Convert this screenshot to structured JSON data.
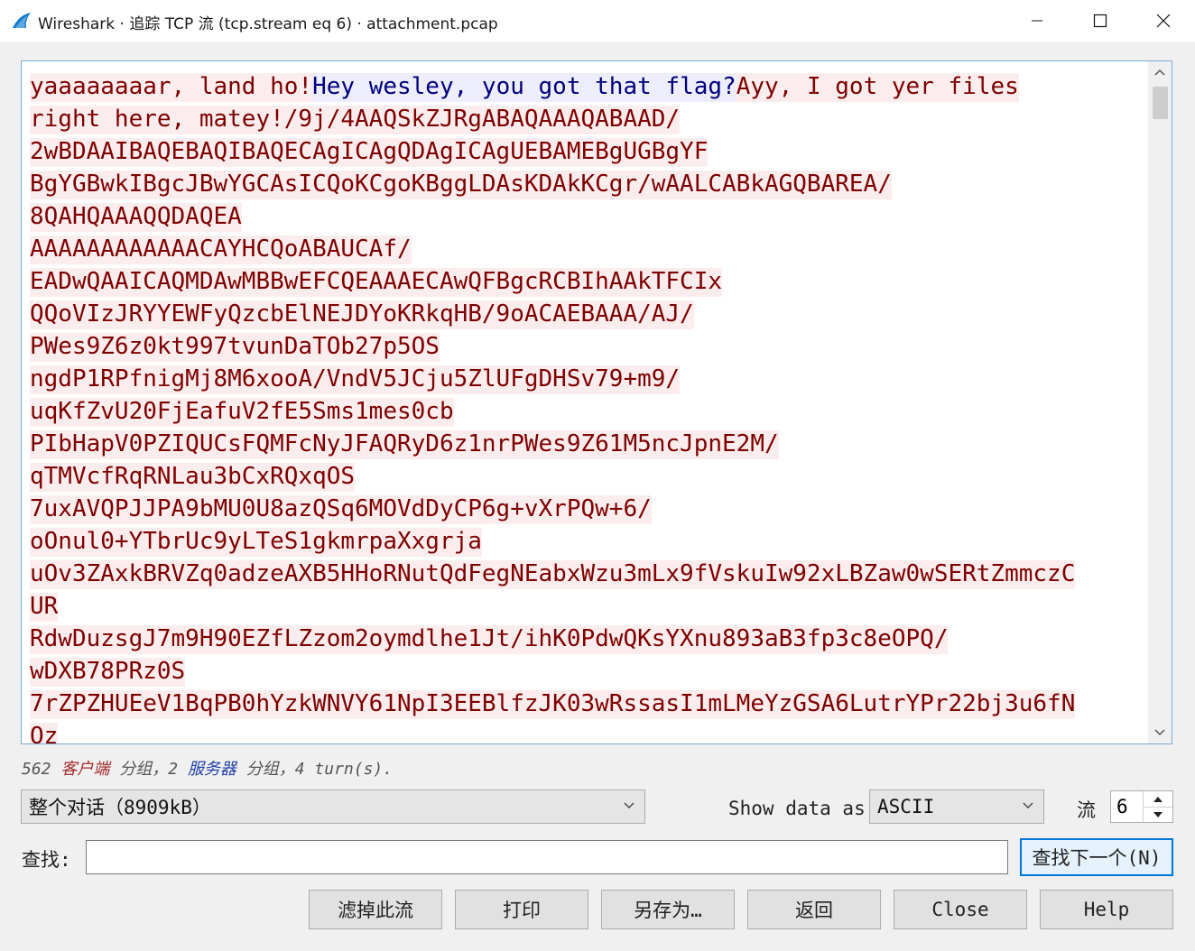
{
  "window": {
    "title": "Wireshark · 追踪 TCP 流 (tcp.stream eq 6) · attachment.pcap"
  },
  "stream": {
    "lines": [
      [
        {
          "t": "yaaaaaaaar, land ho!",
          "k": "cli"
        },
        {
          "t": "Hey wesley, you got that flag?",
          "k": "srv"
        },
        {
          "t": "Ayy, I got yer files",
          "k": "cli"
        }
      ],
      [
        {
          "t": "right here, matey!/9j/4AAQSkZJRgABAQAAAQABAAD/",
          "k": "cli"
        }
      ],
      [
        {
          "t": "2wBDAAIBAQEBAQIBAQECAgICAgQDAgICAgUEBAMEBgUGBgYF",
          "k": "cli"
        }
      ],
      [
        {
          "t": "BgYGBwkIBgcJBwYGCAsICQoKCgoKBggLDAsKDAkKCgr/wAALCABkAGQBAREA/",
          "k": "cli"
        }
      ],
      [
        {
          "t": "8QAHQAAAQQDAQEA",
          "k": "cli"
        }
      ],
      [
        {
          "t": "AAAAAAAAAAAACAYHCQoABAUCAf/",
          "k": "cli"
        }
      ],
      [
        {
          "t": "EADwQAAICAQMDAwMBBwEFCQEAAAECAwQFBgcRCBIhAAkTFCIx",
          "k": "cli"
        }
      ],
      [
        {
          "t": "QQoVIzJRYYEWFyQzcbElNEJDYoKRkqHB/9oACAEBAAA/AJ/",
          "k": "cli"
        }
      ],
      [
        {
          "t": "PWes9Z6z0kt997tvunDaTOb27p5OS",
          "k": "cli"
        }
      ],
      [
        {
          "t": "ngdP1RPfnigMj8M6xooA/VndV5JCju5ZlUFgDHSv79+m9/",
          "k": "cli"
        }
      ],
      [
        {
          "t": "uqKfZvU20FjEafuV2fE5Sms1mes0cb",
          "k": "cli"
        }
      ],
      [
        {
          "t": "PIbHapV0PZIQUCsFQMFcNyJFAQRyD6z1nrPWes9Z61M5ncJpnE2M/",
          "k": "cli"
        }
      ],
      [
        {
          "t": "qTMVcfRqRNLau3bCxRQxqOS",
          "k": "cli"
        }
      ],
      [
        {
          "t": "7uxAVQPJJPA9bMU0U8azQSq6MOVdDyCP6g+vXrPQw+6/",
          "k": "cli"
        }
      ],
      [
        {
          "t": "oOnul0+YTbrUc9yLTeS1gkmrpaXxgrja",
          "k": "cli"
        }
      ],
      [
        {
          "t": "uOv3ZAxkBRVZq0adzeAXB5HHoRNutQdFegNEabxWzu3mLx9fVskuIw92xLBZaw0wSERtZmmczC",
          "k": "cli"
        }
      ],
      [
        {
          "t": "UR",
          "k": "cli"
        }
      ],
      [
        {
          "t": "RdwDuzsgJ7m9H90EZfLZzom2oymdlhe1Jt/ihK0PdwQKsYXnu893aB3fp3c8eOPQ/",
          "k": "cli"
        }
      ],
      [
        {
          "t": "wDXB78PRz0S",
          "k": "cli"
        }
      ],
      [
        {
          "t": "7rZPZHUEeV1BqPB0hYzkWNVY61NpI3EEBlfzJK03wRssasI1mLMeYzGSA6LutrYPr22bj3u6fN",
          "k": "cli"
        }
      ],
      [
        {
          "t": "Oz",
          "k": "cli"
        }
      ]
    ]
  },
  "stats": {
    "client_count": "562",
    "client_label": "客户端",
    "part1": " 分组，",
    "server_count": "2",
    "server_label": "服务器",
    "part2": " 分组，4 turn(s)."
  },
  "controls": {
    "conversation_select": "整个对话（8909kB）",
    "show_data_label": "Show data as",
    "format_select": "ASCII",
    "stream_label": "流",
    "stream_value": "6",
    "find_label": "查找:",
    "find_value": "",
    "find_next_button": "查找下一个(N)"
  },
  "buttons": {
    "filter_out": "滤掉此流",
    "print": "打印",
    "save_as": "另存为…",
    "back": "返回",
    "close": "Close",
    "help": "Help"
  },
  "colors": {
    "client_fg": "#7f0000",
    "client_bg": "#fbeded",
    "server_fg": "#00007f",
    "server_bg": "#ededfb",
    "focus_border": "#0078d7"
  },
  "icons": [
    "wireshark-fin-icon",
    "minimize-icon",
    "maximize-icon",
    "close-icon",
    "chevron-down-icon",
    "spin-up-icon",
    "spin-down-icon",
    "scroll-up-icon",
    "scroll-down-icon"
  ]
}
